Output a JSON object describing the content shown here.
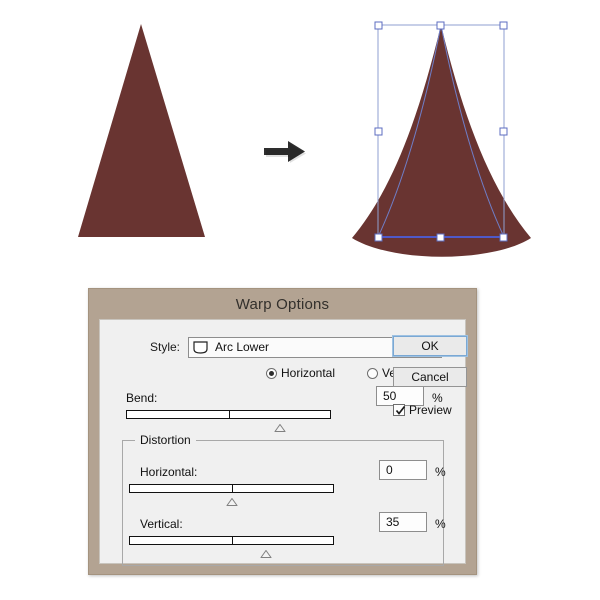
{
  "artwork": {
    "description": "Illustration showing a triangle shape before and after an Arc Lower warp",
    "shape_color": "#693431",
    "selection_color": "#4f59c8",
    "handle_fill": "#ffffff",
    "arrow_icon": "right-arrow-icon",
    "original_shape_name": "triangle",
    "warped_shape_name": "arc-lower-warped-triangle"
  },
  "dialog": {
    "title": "Warp Options",
    "titlebar_color": "#b3a392",
    "body_color": "#f0f0f0",
    "style": {
      "label": "Style:",
      "value": "Arc Lower",
      "icon": "arc-lower-icon",
      "caret": "chevron-down-icon",
      "options": [
        "Arc Lower"
      ]
    },
    "orientation": {
      "horizontal": {
        "label": "Horizontal",
        "selected": true
      },
      "vertical": {
        "label": "Vertical",
        "selected": false
      }
    },
    "bend": {
      "label": "Bend:",
      "value": "50",
      "unit": "%",
      "slider_percent": 75
    },
    "distortion": {
      "legend": "Distortion",
      "horizontal": {
        "label": "Horizontal:",
        "value": "0",
        "unit": "%",
        "slider_percent": 50
      },
      "vertical": {
        "label": "Vertical:",
        "value": "35",
        "unit": "%",
        "slider_percent": 67
      }
    },
    "buttons": {
      "ok": "OK",
      "cancel": "Cancel"
    },
    "preview": {
      "label": "Preview",
      "checked": true,
      "check_icon": "checkmark-icon"
    }
  }
}
